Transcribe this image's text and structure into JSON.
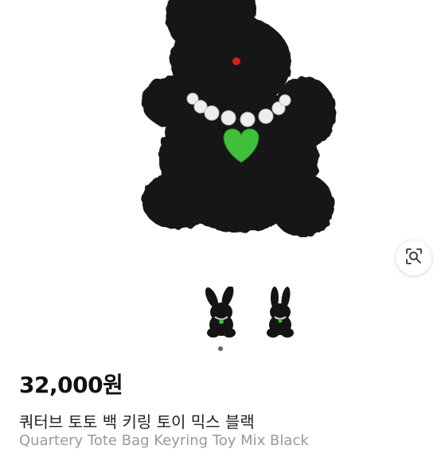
{
  "product": {
    "price": "32,000원",
    "title_kr": "쿼터브 토토 백 키링 토이 믹스 블랙",
    "title_en": "Quartery Tote Bag Keyring Toy Mix Black"
  },
  "gallery": {
    "thumbnail_count": 2,
    "active_index": 0
  },
  "icons": {
    "image_search": "lens-search-icon"
  },
  "colors": {
    "fur": "#141414",
    "eye": "#d4201c",
    "heart_tag": "#3fbf3a",
    "pearl": "#eeeeee",
    "price_text": "#111111",
    "subtitle_text": "#9a9a9a"
  }
}
